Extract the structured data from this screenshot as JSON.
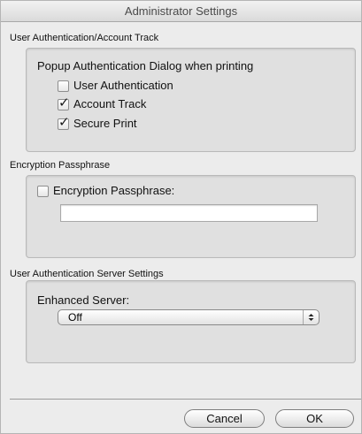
{
  "window": {
    "title": "Administrator Settings"
  },
  "user_auth_section": {
    "label": "User Authentication/Account Track",
    "heading": "Popup Authentication Dialog when printing",
    "options": [
      {
        "label": "User Authentication",
        "checked": false
      },
      {
        "label": "Account Track",
        "checked": true
      },
      {
        "label": "Secure Print",
        "checked": true
      }
    ]
  },
  "encryption_section": {
    "label": "Encryption Passphrase",
    "checkbox_label": "Encryption Passphrase:",
    "checked": false,
    "field_value": ""
  },
  "server_section": {
    "label": "User Authentication Server Settings",
    "field_label": "Enhanced Server:",
    "selected_value": "Off"
  },
  "buttons": {
    "cancel": "Cancel",
    "ok": "OK"
  },
  "check_glyph": "✓"
}
